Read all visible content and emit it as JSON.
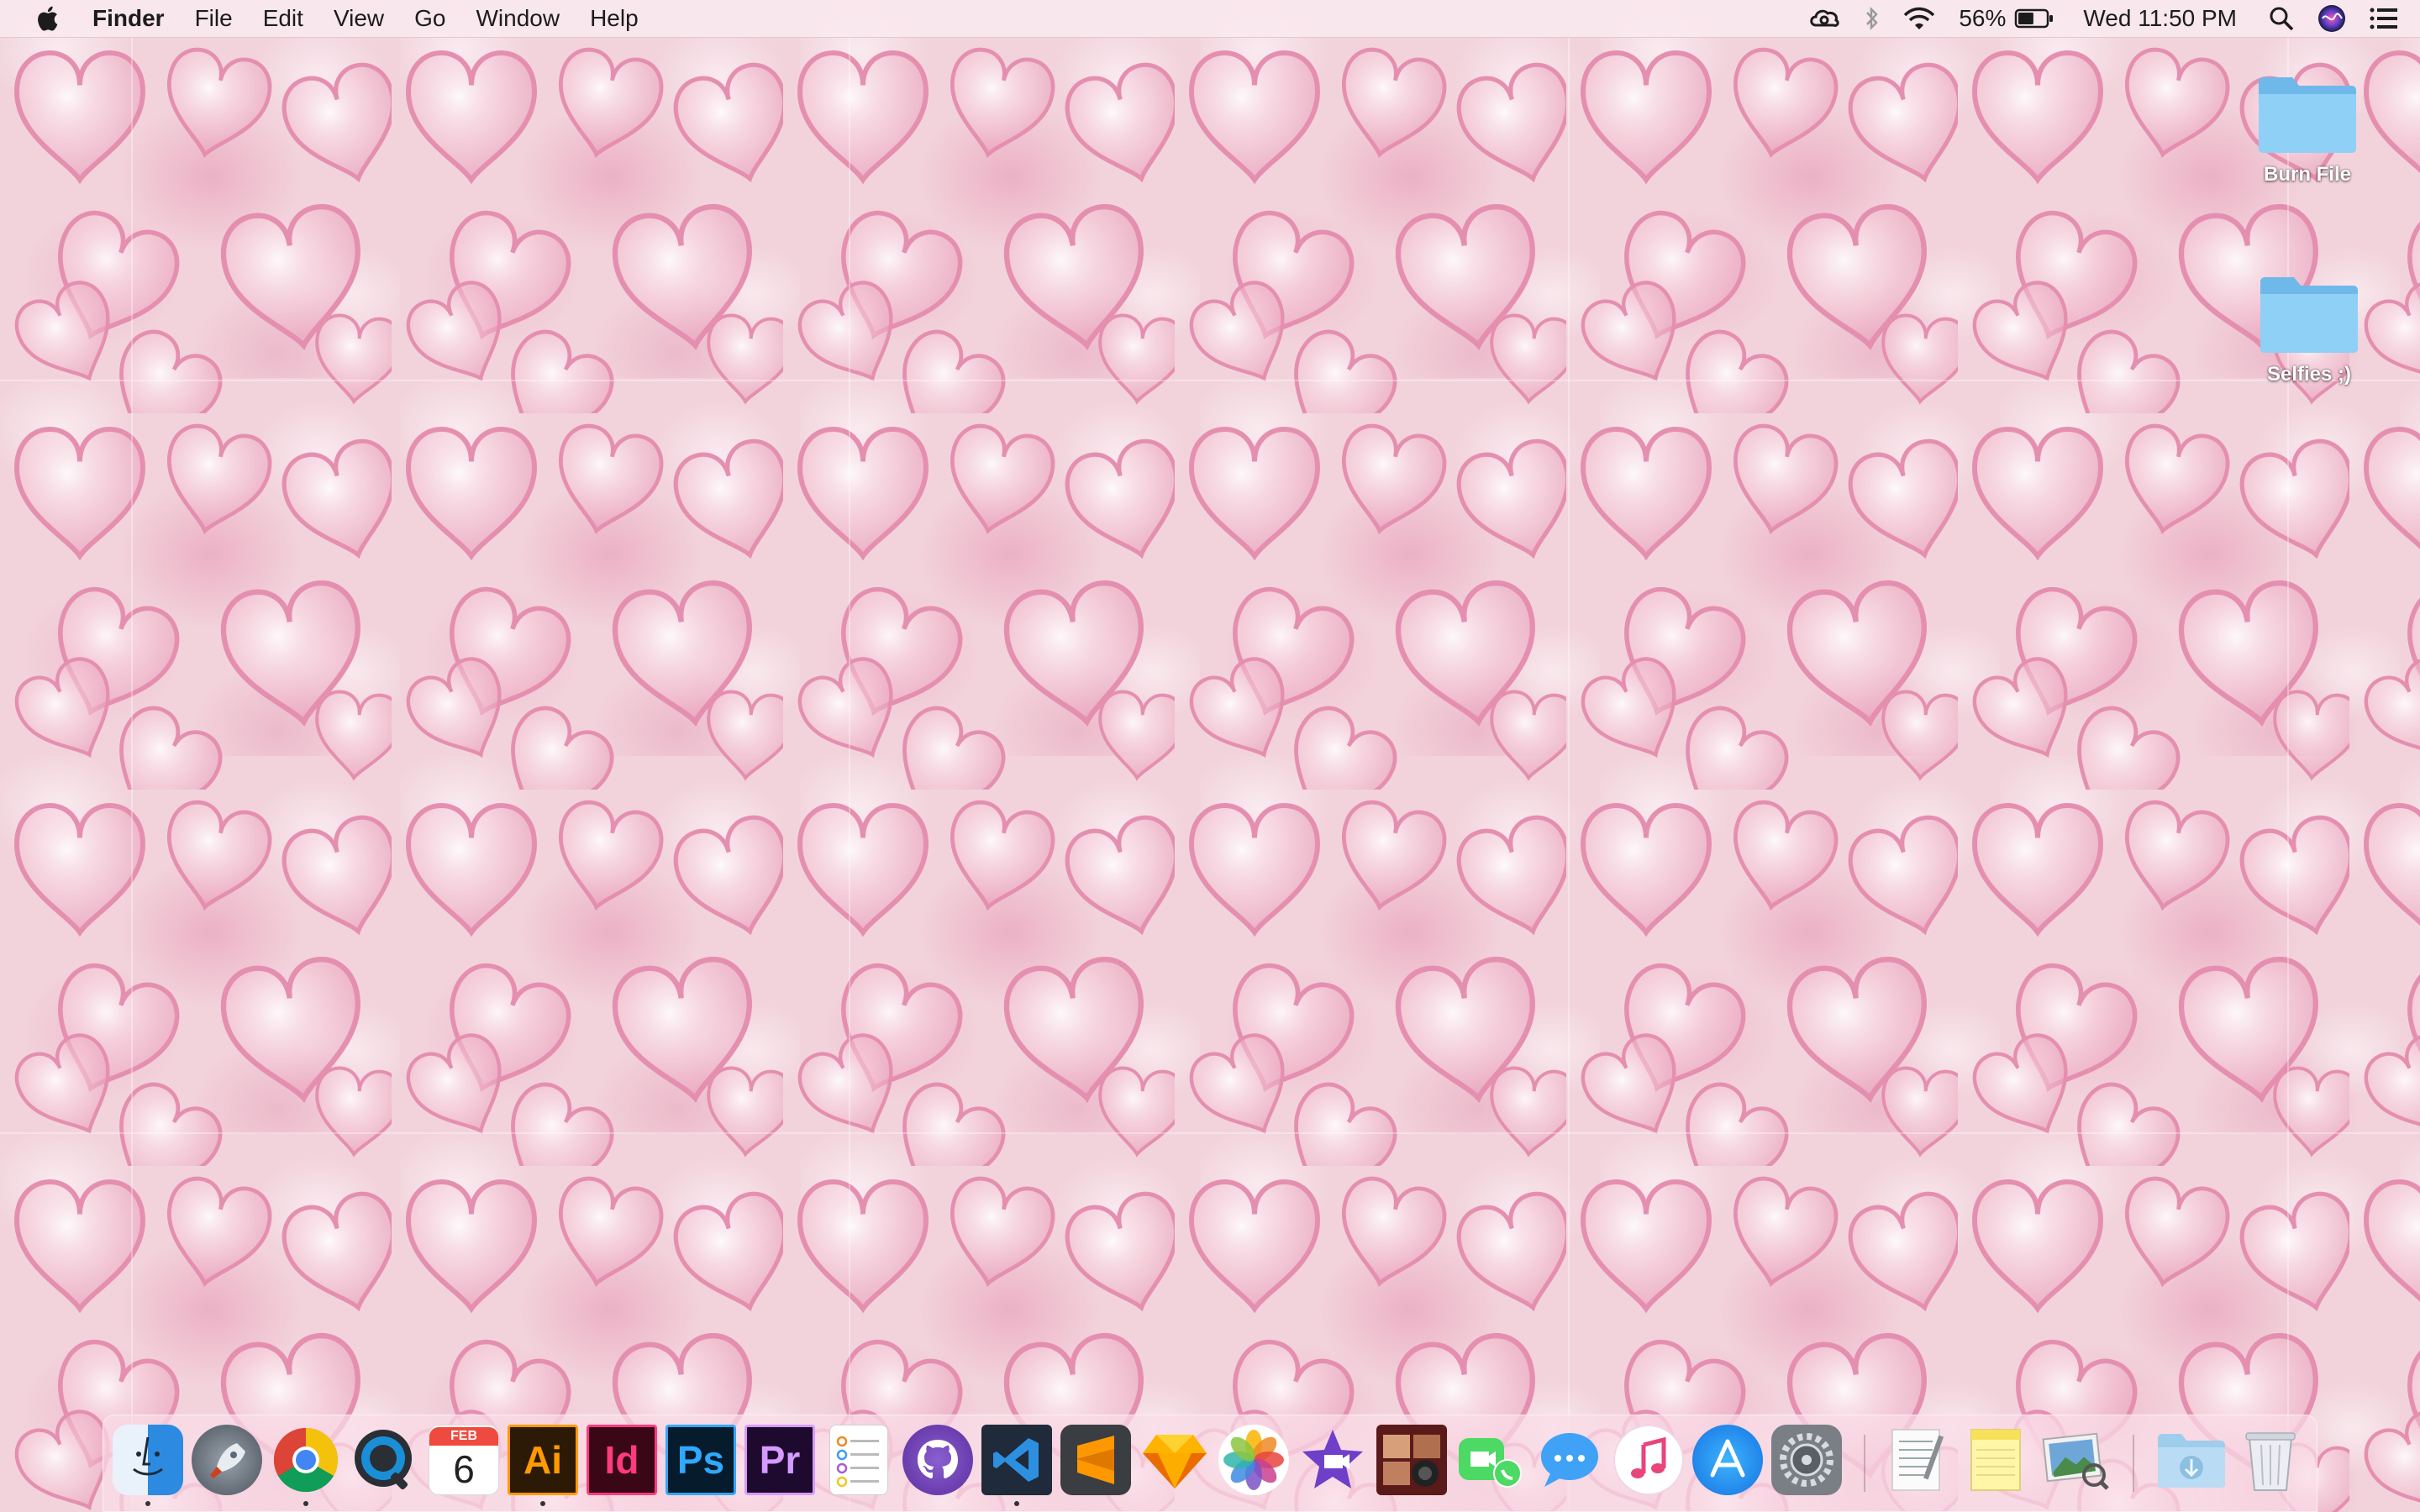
{
  "menubar": {
    "apple_menu": "apple-icon",
    "app_name": "Finder",
    "items": [
      "File",
      "Edit",
      "View",
      "Go",
      "Window",
      "Help"
    ],
    "status": {
      "creative_cloud": "creative-cloud-icon",
      "bluetooth": "bluetooth-icon",
      "wifi": "wifi-icon",
      "battery_percent": "56%",
      "battery_level": 0.56,
      "clock": "Wed 11:50 PM",
      "spotlight": "search-icon",
      "siri": "siri-icon",
      "notifications": "notification-center-icon"
    }
  },
  "desktop": {
    "wallpaper": "pink glass hearts (tiled)",
    "icons": [
      {
        "label": "Burn File",
        "type": "folder"
      },
      {
        "label": "Selfies ;)",
        "type": "folder"
      }
    ]
  },
  "dock": {
    "apps": [
      {
        "name": "Finder",
        "icon": "finder-icon",
        "running": true
      },
      {
        "name": "Launchpad",
        "icon": "launchpad-icon",
        "running": false
      },
      {
        "name": "Google Chrome",
        "icon": "chrome-icon",
        "running": true
      },
      {
        "name": "QuickTime Player",
        "icon": "quicktime-icon",
        "running": false
      },
      {
        "name": "Calendar",
        "icon": "calendar-icon",
        "running": false,
        "month": "FEB",
        "day": "6"
      },
      {
        "name": "Adobe Illustrator",
        "icon": "illustrator-icon",
        "running": true,
        "text": "Ai"
      },
      {
        "name": "Adobe InDesign",
        "icon": "indesign-icon",
        "running": false,
        "text": "Id"
      },
      {
        "name": "Adobe Photoshop",
        "icon": "photoshop-icon",
        "running": false,
        "text": "Ps"
      },
      {
        "name": "Adobe Premiere Pro",
        "icon": "premiere-icon",
        "running": false,
        "text": "Pr"
      },
      {
        "name": "Reminders",
        "icon": "reminders-icon",
        "running": false
      },
      {
        "name": "GitHub Desktop",
        "icon": "github-icon",
        "running": false
      },
      {
        "name": "Visual Studio Code",
        "icon": "vscode-icon",
        "running": true
      },
      {
        "name": "Sublime Text",
        "icon": "sublime-icon",
        "running": false
      },
      {
        "name": "Sketch",
        "icon": "sketch-icon",
        "running": false
      },
      {
        "name": "Photos",
        "icon": "photos-icon",
        "running": false
      },
      {
        "name": "iMovie",
        "icon": "imovie-icon",
        "running": false
      },
      {
        "name": "Photo Booth",
        "icon": "photobooth-icon",
        "running": false
      },
      {
        "name": "FaceTime",
        "icon": "facetime-icon",
        "running": false
      },
      {
        "name": "Messages",
        "icon": "messages-icon",
        "running": false
      },
      {
        "name": "iTunes",
        "icon": "itunes-icon",
        "running": false
      },
      {
        "name": "App Store",
        "icon": "app-store-icon",
        "running": false
      },
      {
        "name": "System Preferences",
        "icon": "system-preferences-icon",
        "running": false
      }
    ],
    "docs": [
      {
        "name": "TextEdit",
        "icon": "textedit-icon"
      },
      {
        "name": "Notes",
        "icon": "notes-icon"
      },
      {
        "name": "Preview",
        "icon": "preview-icon"
      }
    ],
    "stack": [
      {
        "name": "Downloads",
        "icon": "downloads-folder-icon"
      },
      {
        "name": "Trash",
        "icon": "trash-icon"
      }
    ]
  }
}
